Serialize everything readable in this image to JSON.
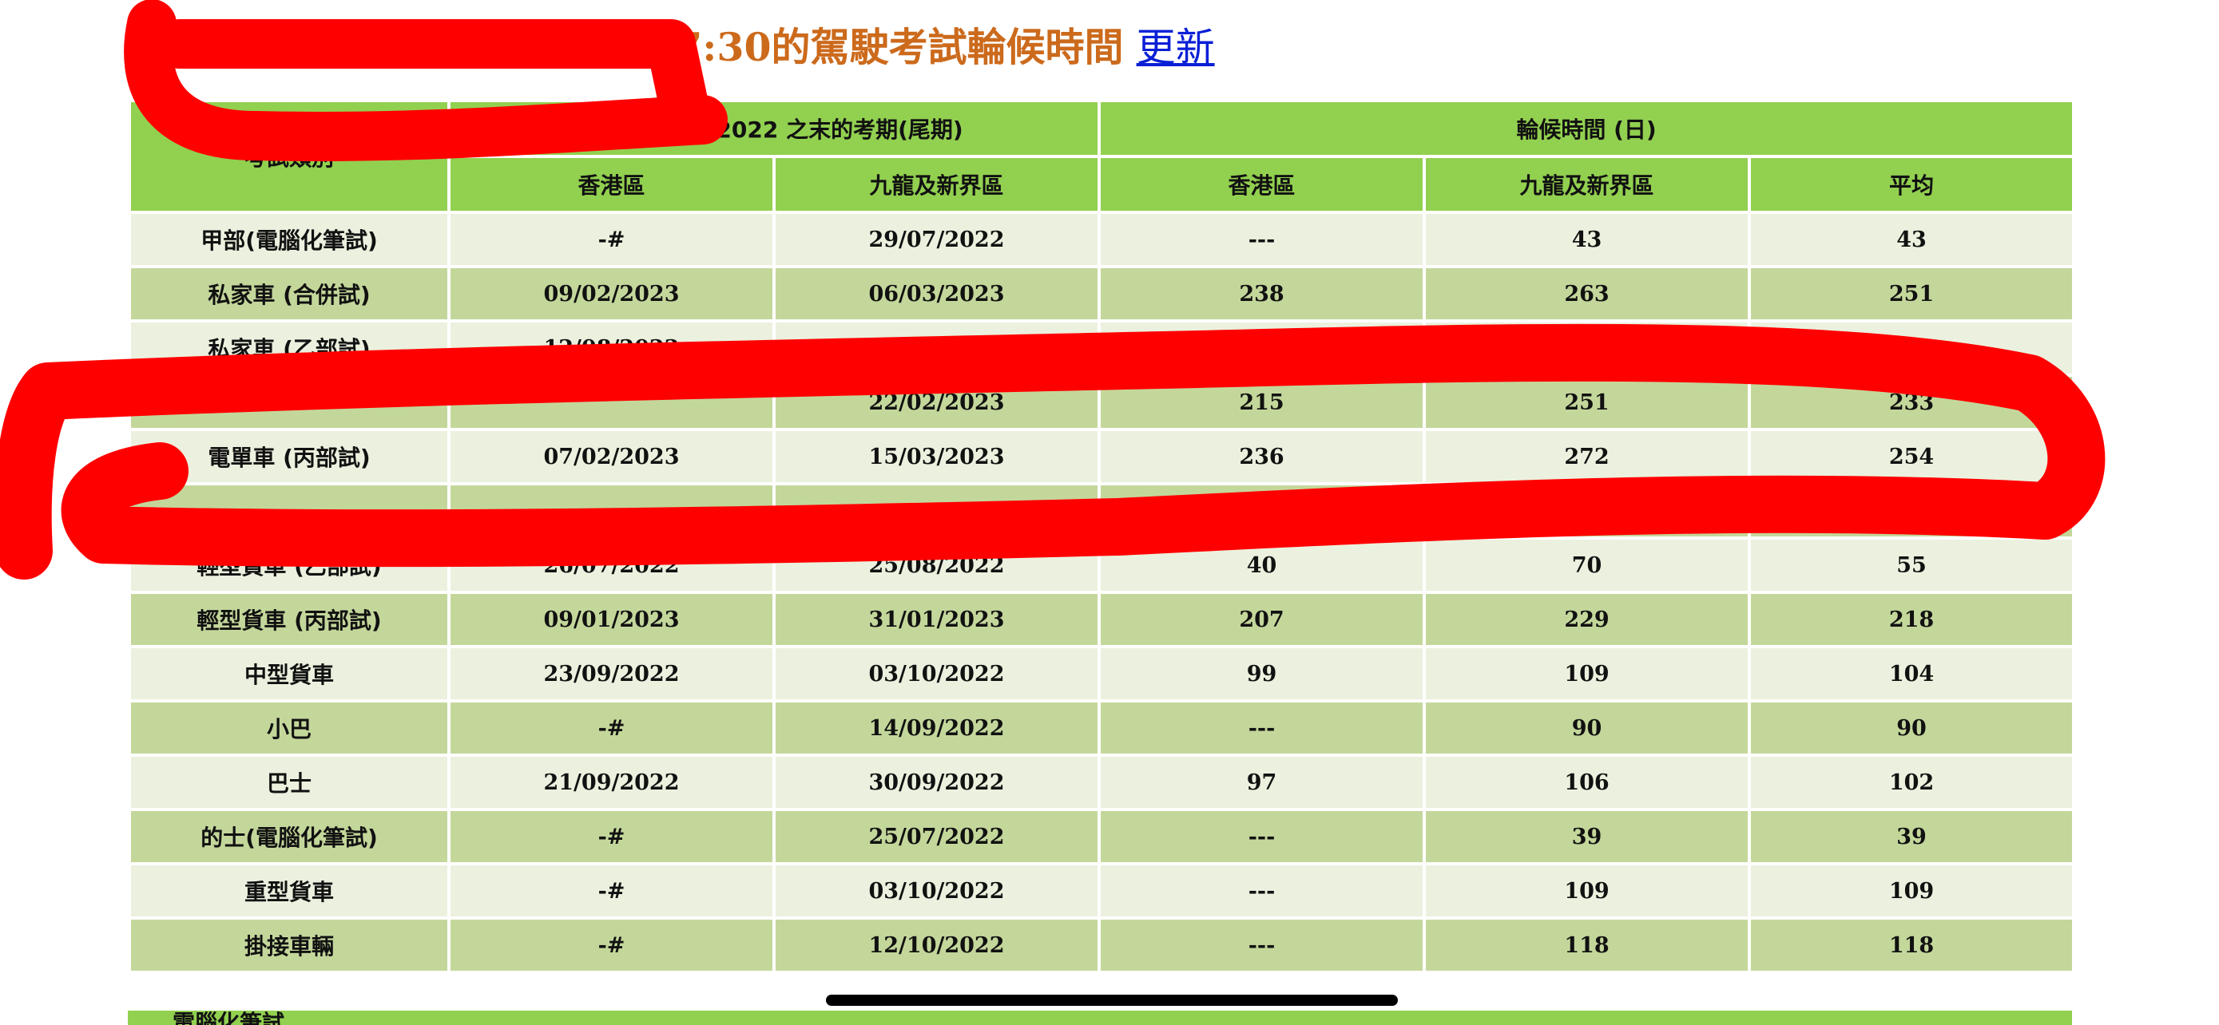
{
  "header": {
    "title": "截至 16/06/2022 (星期四) 17:30的駕駛考試輪候時間",
    "refresh_link": "更新"
  },
  "table": {
    "col_category": "考試類別",
    "group_last_date": "截至 16/06/2022 之末的考期(尾期)",
    "group_wait": "輪候時間 (日)",
    "sub_headers": [
      "香港區",
      "九龍及新界區",
      "香港區",
      "九龍及新界區",
      "平均"
    ],
    "rows": [
      {
        "category": "甲部(電腦化筆試)",
        "hk_date": "-#",
        "kln_date": "29/07/2022",
        "hk_days": "---",
        "kln_days": "43",
        "avg_days": "43"
      },
      {
        "category": "私家車 (合併試)",
        "hk_date": "09/02/2023",
        "kln_date": "06/03/2023",
        "hk_days": "238",
        "kln_days": "263",
        "avg_days": "251"
      },
      {
        "category": "私家車 (乙部試)",
        "hk_date": "12/08/2022",
        "kln_date": "",
        "hk_days": "",
        "kln_days": "",
        "avg_days": ""
      },
      {
        "category": "",
        "hk_date": "",
        "kln_date": "22/02/2023",
        "hk_days": "215",
        "kln_days": "251",
        "avg_days": "233"
      },
      {
        "category": "電單車 (丙部試)",
        "hk_date": "07/02/2023",
        "kln_date": "15/03/2023",
        "hk_days": "236",
        "kln_days": "272",
        "avg_days": "254"
      },
      {
        "category": "",
        "hk_date": "",
        "kln_date": "",
        "hk_days": "",
        "kln_days": "",
        "avg_days": ""
      },
      {
        "category": "輕型貨車 (乙部試)",
        "hk_date": "26/07/2022",
        "kln_date": "25/08/2022",
        "hk_days": "40",
        "kln_days": "70",
        "avg_days": "55"
      },
      {
        "category": "輕型貨車 (丙部試)",
        "hk_date": "09/01/2023",
        "kln_date": "31/01/2023",
        "hk_days": "207",
        "kln_days": "229",
        "avg_days": "218"
      },
      {
        "category": "中型貨車",
        "hk_date": "23/09/2022",
        "kln_date": "03/10/2022",
        "hk_days": "99",
        "kln_days": "109",
        "avg_days": "104"
      },
      {
        "category": "小巴",
        "hk_date": "-#",
        "kln_date": "14/09/2022",
        "hk_days": "---",
        "kln_days": "90",
        "avg_days": "90"
      },
      {
        "category": "巴士",
        "hk_date": "21/09/2022",
        "kln_date": "30/09/2022",
        "hk_days": "97",
        "kln_days": "106",
        "avg_days": "102"
      },
      {
        "category": "的士(電腦化筆試)",
        "hk_date": "-#",
        "kln_date": "25/07/2022",
        "hk_days": "---",
        "kln_days": "39",
        "avg_days": "39"
      },
      {
        "category": "重型貨車",
        "hk_date": "-#",
        "kln_date": "03/10/2022",
        "hk_days": "---",
        "kln_days": "109",
        "avg_days": "109"
      },
      {
        "category": "掛接車輛",
        "hk_date": "-#",
        "kln_date": "12/10/2022",
        "hk_days": "---",
        "kln_days": "118",
        "avg_days": "118"
      }
    ],
    "cut_row_label": "電腦化筆試"
  },
  "colors": {
    "header_green": "#92d050",
    "row_light": "#ebf1de",
    "row_dark": "#c4d79b",
    "title_orange": "#cc6a1c",
    "link_blue": "#0a1fd6",
    "annotation_red": "#ff0000"
  }
}
